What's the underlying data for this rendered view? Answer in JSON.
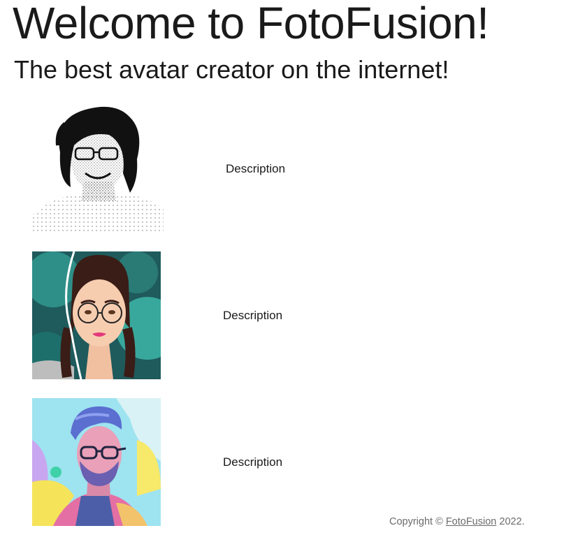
{
  "header": {
    "title": "Welcome to FotoFusion!",
    "subtitle": "The best avatar creator on the internet!"
  },
  "gallery": [
    {
      "icon": "stippled-portrait-woman-avatar",
      "description": "Description"
    },
    {
      "icon": "cartoon-portrait-woman-glasses-avatar",
      "description": "Description"
    },
    {
      "icon": "painted-portrait-man-glasses-avatar",
      "description": "Description"
    }
  ],
  "footer": {
    "prefix": "Copyright © ",
    "link_text": "FotoFusion",
    "suffix": " 2022."
  },
  "colors": {
    "text": "#1a1a1a",
    "footer_text": "#6b6b6b",
    "background": "#ffffff"
  }
}
